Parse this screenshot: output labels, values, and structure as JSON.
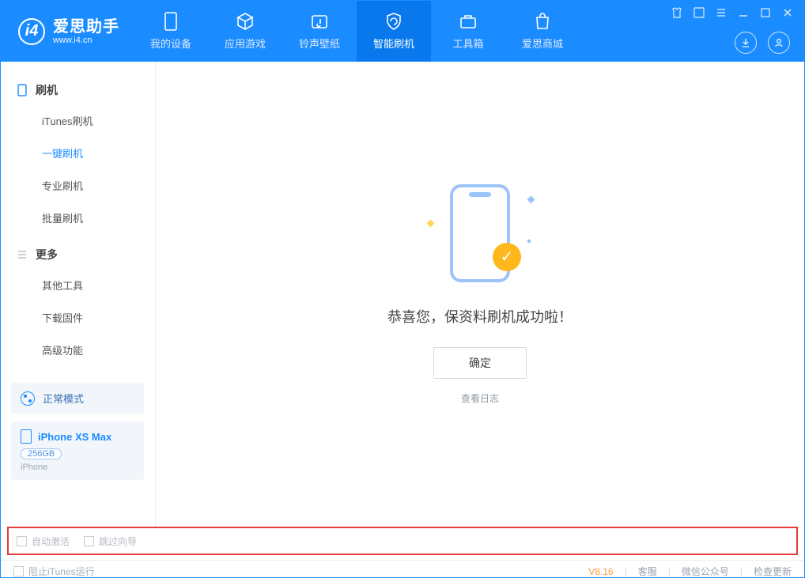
{
  "header": {
    "app_name": "爱思助手",
    "app_url": "www.i4.cn",
    "tabs": [
      {
        "label": "我的设备"
      },
      {
        "label": "应用游戏"
      },
      {
        "label": "铃声壁纸"
      },
      {
        "label": "智能刷机"
      },
      {
        "label": "工具箱"
      },
      {
        "label": "爱思商城"
      }
    ]
  },
  "sidebar": {
    "section1": {
      "title": "刷机",
      "items": [
        {
          "label": "iTunes刷机"
        },
        {
          "label": "一键刷机"
        },
        {
          "label": "专业刷机"
        },
        {
          "label": "批量刷机"
        }
      ]
    },
    "section2": {
      "title": "更多",
      "items": [
        {
          "label": "其他工具"
        },
        {
          "label": "下载固件"
        },
        {
          "label": "高级功能"
        }
      ]
    }
  },
  "device": {
    "mode": "正常模式",
    "name": "iPhone XS Max",
    "capacity": "256GB",
    "type": "iPhone"
  },
  "main": {
    "success_msg": "恭喜您，保资料刷机成功啦！",
    "ok_label": "确定",
    "log_label": "查看日志"
  },
  "options": {
    "auto_activate": "自动激活",
    "skip_guide": "跳过向导"
  },
  "footer": {
    "block_itunes": "阻止iTunes运行",
    "version": "V8.16",
    "links": [
      "客服",
      "微信公众号",
      "检查更新"
    ]
  }
}
